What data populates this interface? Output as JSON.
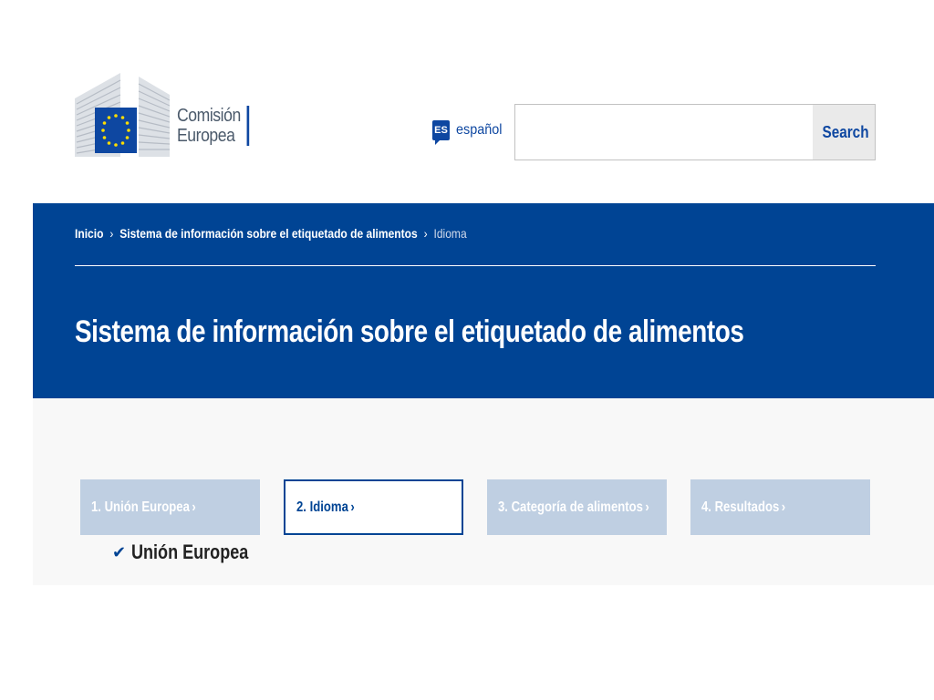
{
  "header": {
    "logo_line1": "Comisión",
    "logo_line2": "Europea",
    "language": {
      "code": "ES",
      "label": "español"
    },
    "search": {
      "placeholder": "",
      "value": "",
      "button_label": "Search"
    }
  },
  "breadcrumb": {
    "items": [
      "Inicio",
      "Sistema de información sobre el etiquetado de alimentos"
    ],
    "current": "Idioma",
    "separator": "›"
  },
  "page_title": "Sistema de información sobre el etiquetado de alimentos",
  "steps": [
    {
      "label": "1. Unión Europea",
      "state": "done"
    },
    {
      "label": "2. Idioma",
      "state": "active"
    },
    {
      "label": "3. Categoría de alimentos",
      "state": "pending"
    },
    {
      "label": "4. Resultados",
      "state": "pending"
    }
  ],
  "selection": {
    "icon": "checkmark-icon",
    "label": "Unión Europea"
  },
  "colors": {
    "brand_blue": "#004494",
    "step_inactive": "#bfcfe2",
    "content_bg": "#f8f8f8"
  }
}
